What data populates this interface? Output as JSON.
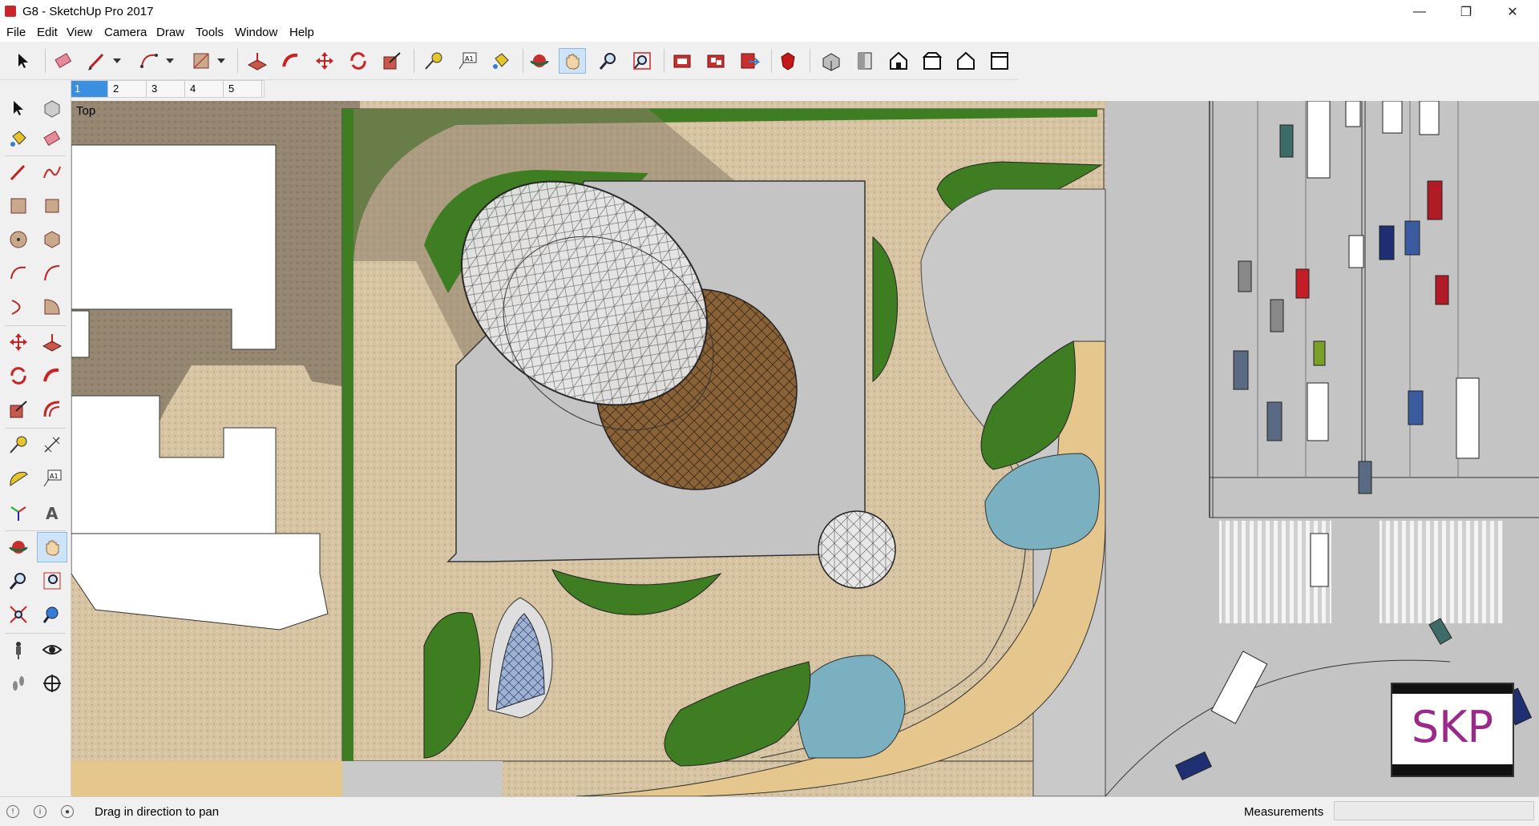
{
  "window": {
    "title": "G8 - SketchUp Pro 2017",
    "minimize_icon": "minimize-icon",
    "maximize_icon": "restore-icon",
    "close_icon": "close-icon"
  },
  "menu": [
    "File",
    "Edit",
    "View",
    "Camera",
    "Draw",
    "Tools",
    "Window",
    "Help"
  ],
  "scenes": [
    "1",
    "2",
    "3",
    "4",
    "5"
  ],
  "viewport": {
    "label": "Top"
  },
  "status": {
    "text": "Drag in direction to pan",
    "measurements_label": "Measurements",
    "measurements_value": ""
  },
  "logo": {
    "text": "SKP"
  },
  "toolbar_icons": [
    "select-icon",
    "eraser-icon",
    "pencil-icon",
    "arc-icon",
    "rectangle-icon",
    "push-pull-icon",
    "follow-me-icon",
    "move-icon",
    "rotate-icon",
    "scale-icon",
    "tape-measure-icon",
    "text-icon",
    "paint-bucket-icon",
    "orbit-icon",
    "pan-icon",
    "zoom-icon",
    "zoom-extents-icon",
    "3d-warehouse-icon",
    "extension-warehouse-icon",
    "send-to-layout-icon",
    "ruby-console-icon",
    "iso-view-icon",
    "top-view-icon",
    "front-view-icon",
    "right-view-icon",
    "back-view-icon",
    "left-view-icon"
  ],
  "colors": {
    "grass": "#3f7d22",
    "paving": "#d9c8a4",
    "road": "#c9c9c9",
    "roof": "#c4c4c4",
    "water": "#7ab0c0",
    "sand": "#e8c98f",
    "shadow": "#8b7d68"
  }
}
